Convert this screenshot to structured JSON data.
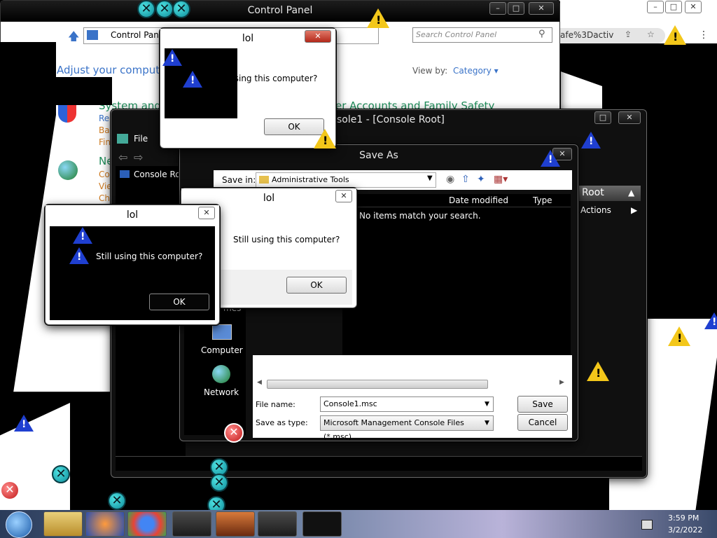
{
  "control_panel": {
    "title": "Control Panel",
    "breadcrumb": "Control Panel",
    "search_placeholder": "Search Control Panel",
    "heading": "Adjust your computer",
    "view_by_label": "View by:",
    "view_by_value": "Category",
    "system_link": "System and",
    "user_accounts_link": "er Accounts and Family Safety",
    "network_link": "Ne",
    "snippets": [
      "Re",
      "Bac",
      "Fin",
      "Co",
      "Vie",
      "Ch"
    ]
  },
  "browser_fragment": {
    "url_text": "afe%3Dactiv"
  },
  "mmc": {
    "title": "sole1 - [Console Root]",
    "menu_file": "File",
    "tree_item": "Console Roo",
    "actions_header": "Root",
    "actions_item": "Actions"
  },
  "save_as": {
    "title": "Save As",
    "save_in_label": "Save in:",
    "save_in_value": "Administrative Tools",
    "columns": [
      "Date modified",
      "Type"
    ],
    "empty_message": "No items match your search.",
    "nav": [
      "Computer",
      "Network",
      "mes"
    ],
    "file_name_label": "File name:",
    "file_name_value": "Console1.msc",
    "save_as_type_label": "Save as type:",
    "save_as_type_value": "Microsoft Management Console Files (*.msc)",
    "save_button": "Save",
    "cancel_button": "Cancel"
  },
  "lol_dialogs": [
    {
      "title": "lol",
      "message": "Still using this computer?",
      "ok": "OK"
    },
    {
      "title": "lol",
      "message": "Still using this computer?",
      "ok": "OK"
    },
    {
      "title": "lol",
      "message": "Still using this computer?",
      "ok": "OK"
    }
  ],
  "taskbar": {
    "time": "3:59 PM",
    "date": "3/2/2022"
  },
  "colors": {
    "link_blue": "#3a73c8",
    "warning_yellow": "#f3c71a",
    "info_blue": "#1f3fd0",
    "teal_error": "#0e8d9b"
  }
}
